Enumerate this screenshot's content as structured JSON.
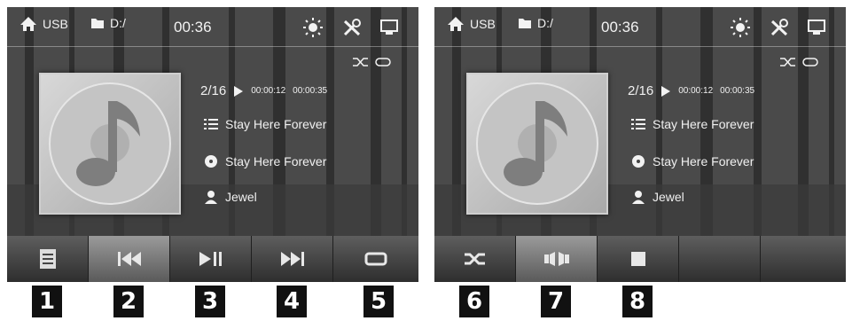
{
  "screens": [
    {
      "status": {
        "source": "USB",
        "folder": "D:/",
        "time": "00:36"
      },
      "track": {
        "number": "2/16",
        "elapsed": "00:00:12",
        "total": "00:00:35"
      },
      "song": {
        "playlist": "Stay Here Forever",
        "album": "Stay Here Forever",
        "artist": "Jewel"
      },
      "controls": [
        "file-list",
        "previous",
        "play-pause",
        "next",
        "repeat"
      ]
    },
    {
      "status": {
        "source": "USB",
        "folder": "D:/",
        "time": "00:36"
      },
      "track": {
        "number": "2/16",
        "elapsed": "00:00:12",
        "total": "00:00:35"
      },
      "song": {
        "playlist": "Stay Here Forever",
        "album": "Stay Here Forever",
        "artist": "Jewel"
      },
      "controls": [
        "shuffle",
        "eq",
        "stop"
      ]
    }
  ],
  "callouts": [
    "1",
    "2",
    "3",
    "4",
    "5",
    "6",
    "7",
    "8"
  ],
  "colors": {
    "text": "#f2f2f2",
    "badge": "#111111",
    "bar": "#3a3a3a"
  }
}
